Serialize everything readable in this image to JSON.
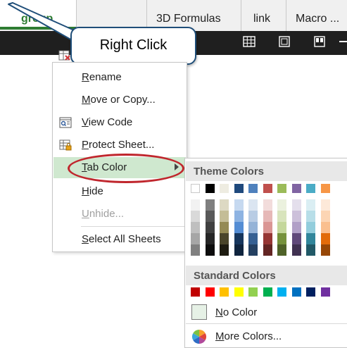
{
  "callout": {
    "text": "Right Click"
  },
  "tabs": {
    "active": "group",
    "others": [
      "3D Formulas",
      "link",
      "Macro ..."
    ]
  },
  "context_menu": {
    "items": [
      {
        "label": "Rename",
        "accel": "R",
        "rest": "ename",
        "disabled": false,
        "icon": ""
      },
      {
        "label": "Move or Copy...",
        "accel": "M",
        "rest": "ove or Copy...",
        "disabled": false,
        "icon": ""
      },
      {
        "label": "View Code",
        "accel": "V",
        "rest": "iew Code",
        "disabled": false,
        "icon": "view-code-icon"
      },
      {
        "label": "Protect Sheet...",
        "accel": "P",
        "rest": "rotect Sheet...",
        "disabled": false,
        "icon": "protect-sheet-icon"
      },
      {
        "label": "Tab Color",
        "accel": "T",
        "rest": "ab Color",
        "disabled": false,
        "icon": "",
        "active": true,
        "has_submenu": true
      },
      {
        "label": "Hide",
        "accel": "H",
        "rest": "ide",
        "disabled": false,
        "icon": ""
      },
      {
        "label": "Unhide...",
        "accel": "U",
        "rest": "nhide...",
        "disabled": true,
        "icon": ""
      },
      {
        "label": "Select All Sheets",
        "accel": "S",
        "rest": "elect All Sheets",
        "disabled": false,
        "icon": ""
      }
    ]
  },
  "tab_color_menu": {
    "theme_header": "Theme Colors",
    "standard_header": "Standard Colors",
    "no_color": {
      "accel": "N",
      "rest": "o Color"
    },
    "more_colors": {
      "accel": "M",
      "rest": "ore Colors..."
    },
    "theme_colors": [
      "#FFFFFF",
      "#000000",
      "#EEECE1",
      "#1F497D",
      "#4F81BD",
      "#C0504D",
      "#9BBB59",
      "#8064A2",
      "#4BACC6",
      "#F79646"
    ],
    "theme_shades": [
      [
        "#F2F2F2",
        "#D9D9D9",
        "#BFBFBF",
        "#A6A6A6",
        "#808080"
      ],
      [
        "#7F7F7F",
        "#595959",
        "#404040",
        "#262626",
        "#0D0D0D"
      ],
      [
        "#DDD9C3",
        "#C4BD97",
        "#948A54",
        "#4A452A",
        "#1E1C11"
      ],
      [
        "#C6D9F0",
        "#8DB3E2",
        "#548DD4",
        "#17365D",
        "#0F243E"
      ],
      [
        "#DBE5F1",
        "#B8CCE4",
        "#95B3D7",
        "#366092",
        "#244061"
      ],
      [
        "#F2DCDB",
        "#E6B8B7",
        "#DA9694",
        "#963634",
        "#632523"
      ],
      [
        "#EBF1DE",
        "#D8E4BC",
        "#C4D79B",
        "#76923C",
        "#4F6228"
      ],
      [
        "#E4DFEC",
        "#CCC0DA",
        "#B1A0C7",
        "#60497A",
        "#403151"
      ],
      [
        "#DAEEF3",
        "#B7DEE8",
        "#92CDDC",
        "#31869B",
        "#215967"
      ],
      [
        "#FDE9D9",
        "#FCD5B4",
        "#FABF8F",
        "#E26B0A",
        "#974706"
      ]
    ],
    "standard_colors": [
      "#C00000",
      "#FF0000",
      "#FFC000",
      "#FFFF00",
      "#92D050",
      "#00B050",
      "#00B0F0",
      "#0070C0",
      "#002060",
      "#7030A0"
    ]
  }
}
